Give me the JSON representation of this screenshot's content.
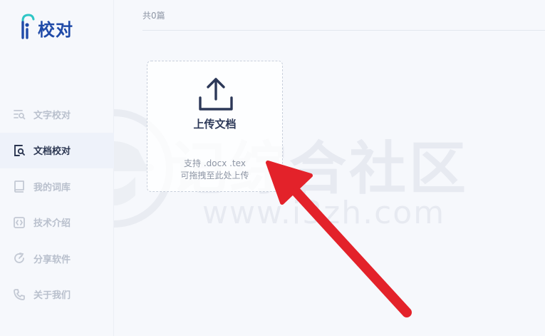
{
  "app": {
    "name": "校对"
  },
  "sidebar": {
    "items": [
      {
        "label": "文字校对",
        "icon": "text-proof-icon",
        "active": false
      },
      {
        "label": "文档校对",
        "icon": "document-proof-icon",
        "active": true
      },
      {
        "label": "我的词库",
        "icon": "dictionary-icon",
        "active": false
      },
      {
        "label": "技术介绍",
        "icon": "tech-intro-icon",
        "active": false
      },
      {
        "label": "分享软件",
        "icon": "share-icon",
        "active": false
      },
      {
        "label": "关于我们",
        "icon": "phone-icon",
        "active": false
      }
    ]
  },
  "main": {
    "count_label": "共0篇",
    "upload": {
      "title": "上传文档",
      "hint_line1": "支持 .docx .tex",
      "hint_line2": "可拖拽至此处上传",
      "icon": "upload-icon"
    }
  },
  "watermark": {
    "text": "记综合社区",
    "url": "www.i3zh.com"
  },
  "colors": {
    "brand": "#1f4aa8",
    "accent_teal": "#2ec6c6",
    "arrow_red": "#e3222a",
    "active_bg": "#eef2fa"
  }
}
